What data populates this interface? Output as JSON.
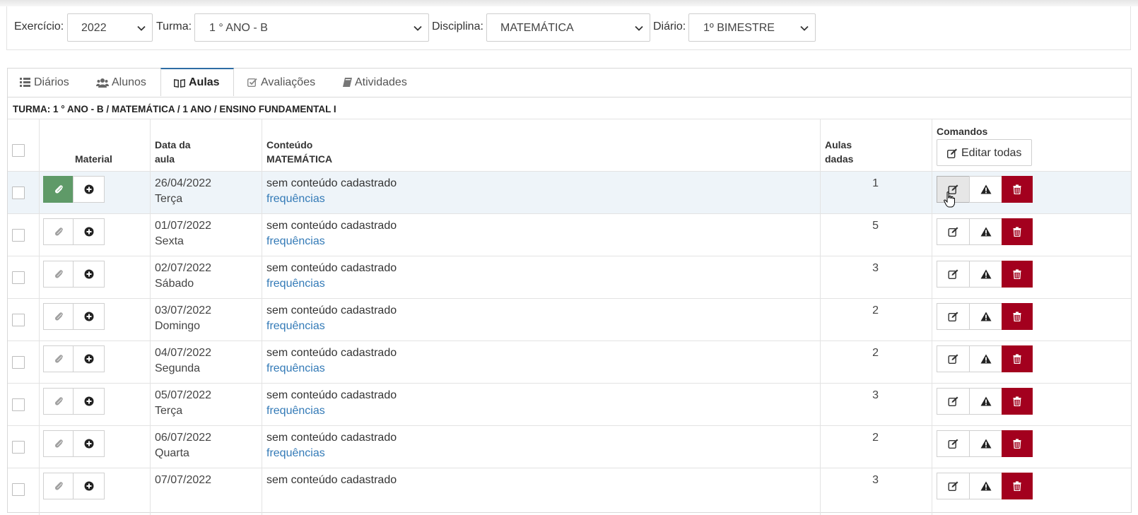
{
  "filters": {
    "exercicio": {
      "label": "Exercício:",
      "value": "2022"
    },
    "turma": {
      "label": "Turma:",
      "value": "1 ° ANO - B"
    },
    "disciplina": {
      "label": "Disciplina:",
      "value": "MATEMÁTICA"
    },
    "diario": {
      "label": "Diário:",
      "value": "1º BIMESTRE"
    }
  },
  "tabs": [
    {
      "label": "Diários",
      "icon": "list-icon",
      "active": false
    },
    {
      "label": "Alunos",
      "icon": "users-icon",
      "active": false
    },
    {
      "label": "Aulas",
      "icon": "book-icon",
      "active": true
    },
    {
      "label": "Avaliações",
      "icon": "check-square-icon",
      "active": false
    },
    {
      "label": "Atividades",
      "icon": "book-small-icon",
      "active": false
    }
  ],
  "turma_info": "TURMA: 1 ° ANO - B / MATEMÁTICA / 1 ANO / ENSINO FUNDAMENTAL I",
  "table": {
    "headers": {
      "material": "Material",
      "data_line1": "Data da",
      "data_line2": "aula",
      "conteudo_line1": "Conteúdo",
      "conteudo_line2": "MATEMÁTICA",
      "aulas_line1": "Aulas",
      "aulas_line2": "dadas",
      "comandos": "Comandos",
      "editar_todas": "Editar todas"
    },
    "rows": [
      {
        "date": "26/04/2022",
        "day": "Terça",
        "content": "sem conteúdo cadastrado",
        "link": "frequências",
        "aulas": "1",
        "material_attached": true,
        "highlighted": true
      },
      {
        "date": "01/07/2022",
        "day": "Sexta",
        "content": "sem conteúdo cadastrado",
        "link": "frequências",
        "aulas": "5",
        "material_attached": false,
        "highlighted": false
      },
      {
        "date": "02/07/2022",
        "day": "Sábado",
        "content": "sem conteúdo cadastrado",
        "link": "frequências",
        "aulas": "3",
        "material_attached": false,
        "highlighted": false
      },
      {
        "date": "03/07/2022",
        "day": "Domingo",
        "content": "sem conteúdo cadastrado",
        "link": "frequências",
        "aulas": "2",
        "material_attached": false,
        "highlighted": false
      },
      {
        "date": "04/07/2022",
        "day": "Segunda",
        "content": "sem conteúdo cadastrado",
        "link": "frequências",
        "aulas": "2",
        "material_attached": false,
        "highlighted": false
      },
      {
        "date": "05/07/2022",
        "day": "Terça",
        "content": "sem conteúdo cadastrado",
        "link": "frequências",
        "aulas": "3",
        "material_attached": false,
        "highlighted": false
      },
      {
        "date": "06/07/2022",
        "day": "Quarta",
        "content": "sem conteúdo cadastrado",
        "link": "frequências",
        "aulas": "2",
        "material_attached": false,
        "highlighted": false
      },
      {
        "date": "07/07/2022",
        "day": "",
        "content": "sem conteúdo cadastrado",
        "link": "",
        "aulas": "3",
        "material_attached": false,
        "highlighted": false
      }
    ]
  },
  "colors": {
    "link": "#337ab7",
    "danger": "#a3001e",
    "success": "#5f9a68",
    "active_tab_border": "#2e6da4"
  }
}
